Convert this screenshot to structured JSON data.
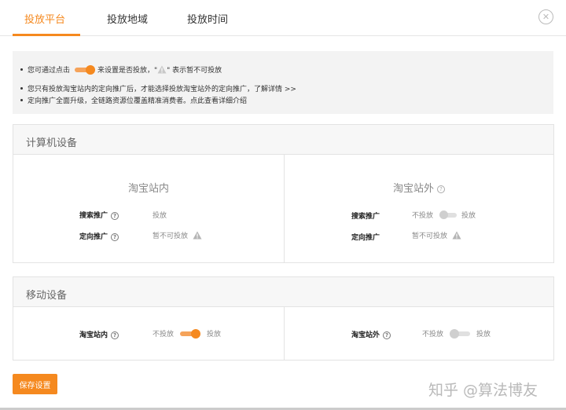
{
  "tabs": [
    {
      "label": "投放平台",
      "active": true
    },
    {
      "label": "投放地域",
      "active": false
    },
    {
      "label": "投放时间",
      "active": false
    }
  ],
  "notice": {
    "line1_prefix": "您可通过点击",
    "line1_middle": "来设置是否投放，\"",
    "line1_suffix": "\" 表示暂不可投放",
    "line2": "您只有投放淘宝站内的定向推广后，才能选择投放淘宝站外的定向推广，",
    "line2_link": "了解详情 >>",
    "line3": "定向推广全面升级，全链路资源位覆盖精准消费者。",
    "line3_link": "点此查看详细介绍"
  },
  "computer": {
    "title": "计算机设备",
    "inside": {
      "title": "淘宝站内",
      "rows": [
        {
          "label": "搜索推广",
          "value": "投放"
        },
        {
          "label": "定向推广",
          "value": "暂不可投放"
        }
      ]
    },
    "outside": {
      "title": "淘宝站外",
      "rows": [
        {
          "label": "搜索推广",
          "off_label": "不投放",
          "on_label": "投放"
        },
        {
          "label": "定向推广",
          "value": "暂不可投放"
        }
      ]
    }
  },
  "mobile": {
    "title": "移动设备",
    "inside": {
      "label": "淘宝站内",
      "off_label": "不投放",
      "on_label": "投放",
      "enabled": true
    },
    "outside": {
      "label": "淘宝站外",
      "off_label": "不投放",
      "on_label": "投放",
      "enabled": false
    }
  },
  "save_label": "保存设置",
  "watermark": "知乎 @算法博友",
  "colors": {
    "accent": "#f5891f",
    "toggle_off": "#cfcfcf"
  }
}
